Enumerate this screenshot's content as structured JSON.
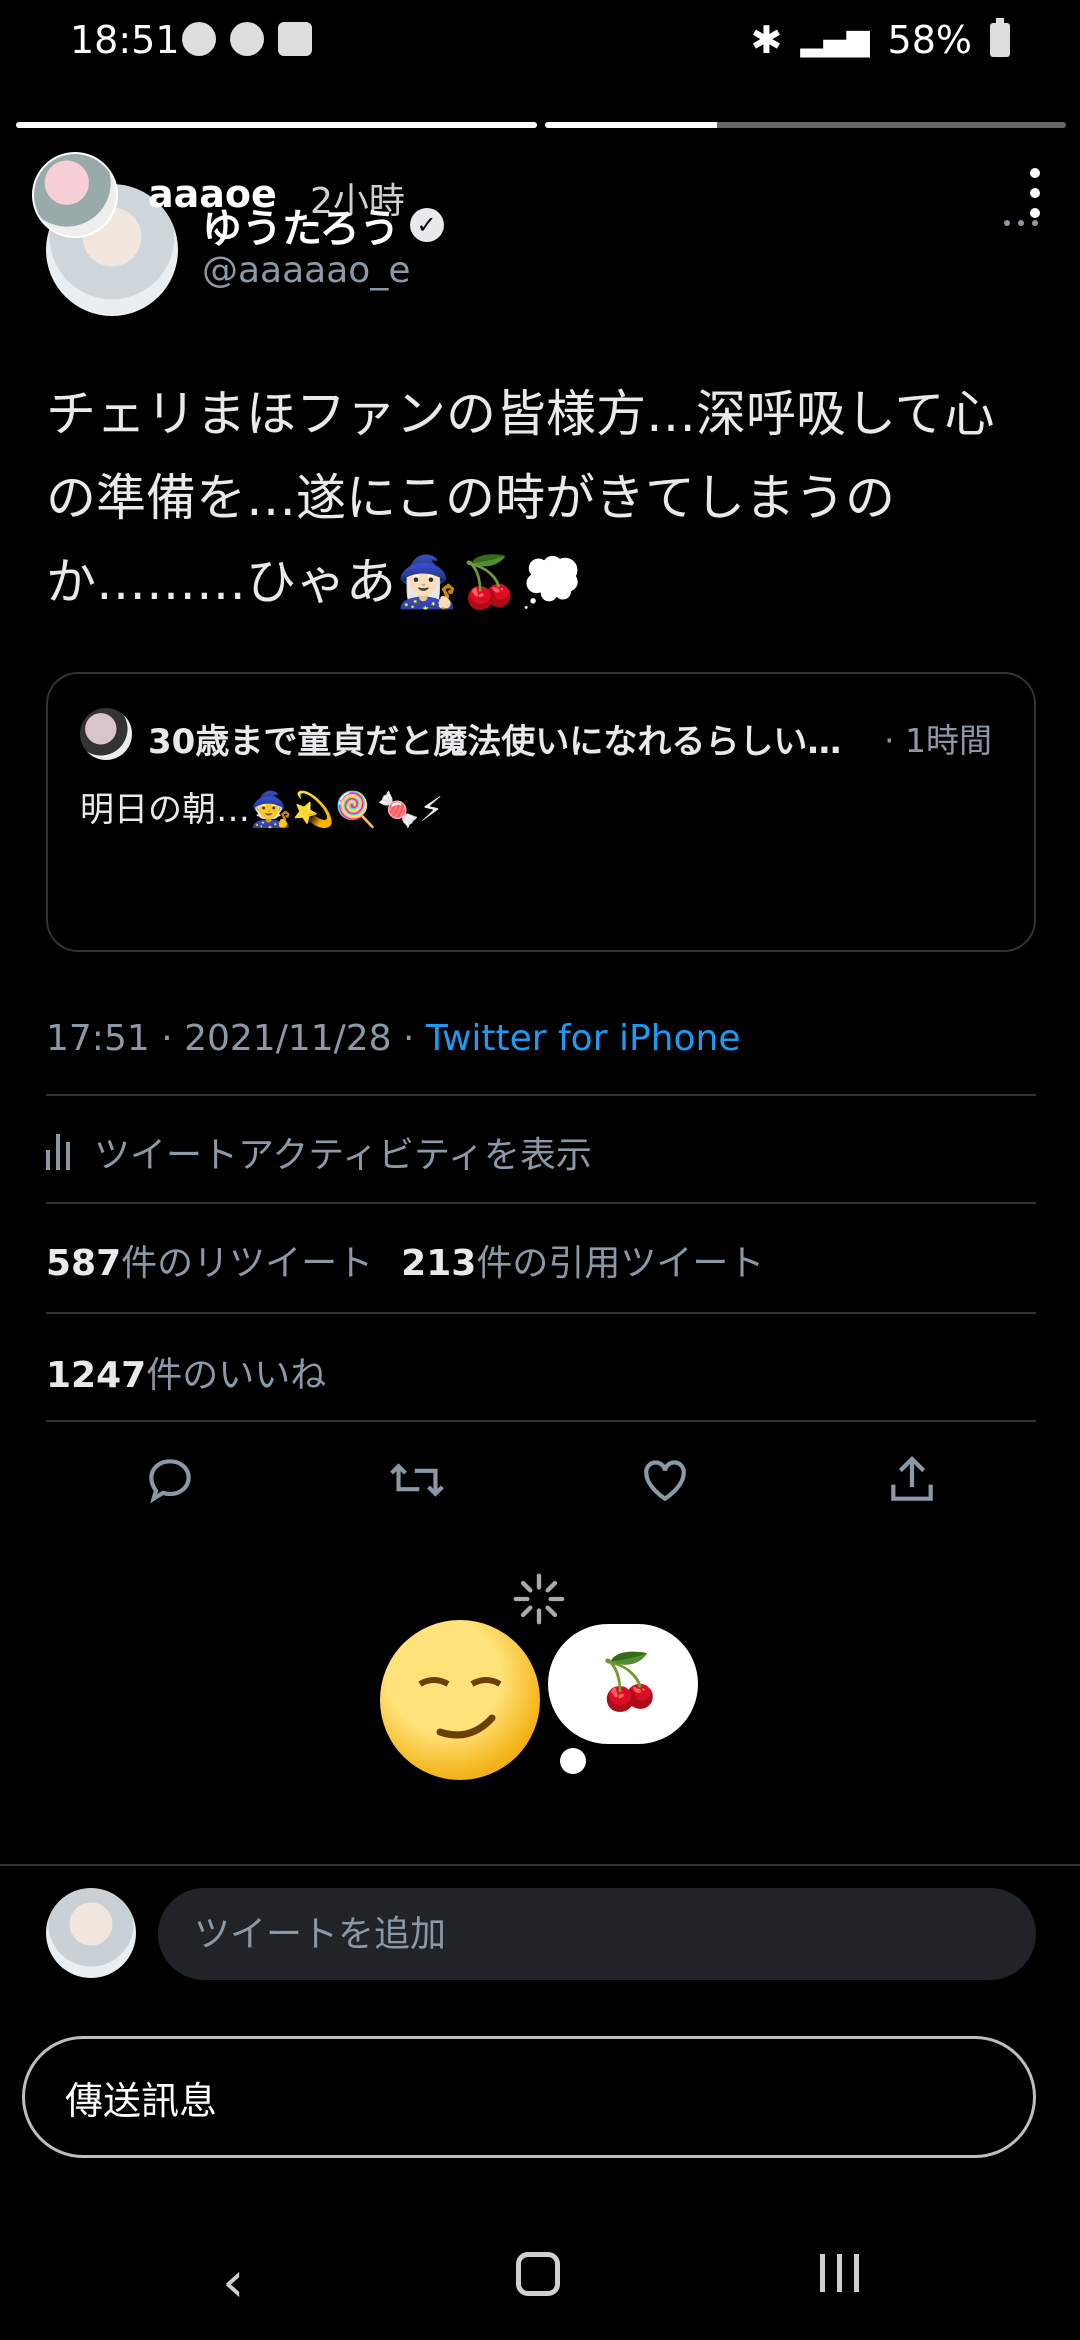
{
  "status_bar": {
    "time": "18:51",
    "battery": "58%",
    "icons_left": [
      "chat-bubble-icon",
      "shazam-icon",
      "check-square-icon"
    ],
    "icons_right": [
      "bluetooth-icon",
      "4g-plus-icon",
      "signal-icon",
      "battery-icon"
    ]
  },
  "story": {
    "username": "aaaoe",
    "time_ago": "2小時",
    "progress": [
      1.0,
      0.33
    ]
  },
  "tweet": {
    "display_name": "ゆうたろう",
    "handle": "@aaaaao_e",
    "text": "チェリまほファンの皆様方…深呼吸して心の準備を…遂にこの時がきてしまうのか………ひゃあ🧙🏻‍♀️🍒💭",
    "timestamp": "17:51 · 2021/11/28 · ",
    "source": "Twitter for iPhone",
    "activity_label": "ツイートアクティビティを表示",
    "retweets_count": "587",
    "retweets_label": "件のリツイート",
    "quotes_count": "213",
    "quotes_label": "件の引用ツイート",
    "likes_count": "1247",
    "likes_label": "件のいいね"
  },
  "quote_tweet": {
    "name": "30歳まで童貞だと魔法使いになれるらしい…",
    "time": "· 1時間",
    "text": "明日の朝…🧙💫🍭🍬⚡"
  },
  "sticker": {
    "cherry": "🍒"
  },
  "reply": {
    "placeholder": "ツイートを追加"
  },
  "message": {
    "send_label": "傳送訊息"
  },
  "nav": {
    "back": "‹"
  }
}
